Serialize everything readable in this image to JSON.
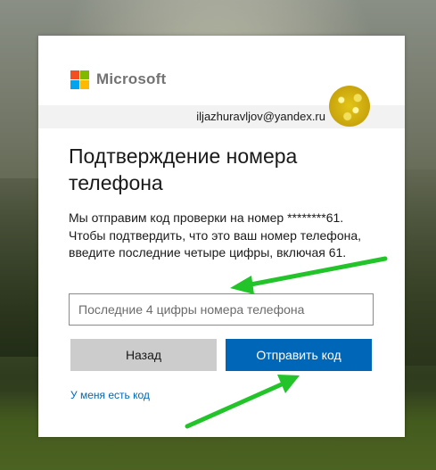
{
  "brand": {
    "name": "Microsoft"
  },
  "identity": {
    "email": "iljazhuravljov@yandex.ru"
  },
  "page": {
    "title": "Подтверждение номера телефона",
    "description": "Мы отправим код проверки на номер ********61. Чтобы подтвердить, что это ваш номер телефона, введите последние четыре цифры, включая 61."
  },
  "phone_input": {
    "placeholder": "Последние 4 цифры номера телефона",
    "value": ""
  },
  "buttons": {
    "back": "Назад",
    "send": "Отправить код"
  },
  "links": {
    "have_code": "У меня есть код"
  },
  "colors": {
    "accent": "#0067b8",
    "secondary_button": "#cccccc",
    "annotation_arrow": "#22c42a"
  },
  "icons": [
    "microsoft-logo-icon",
    "user-avatar",
    "green-arrow-icon"
  ]
}
